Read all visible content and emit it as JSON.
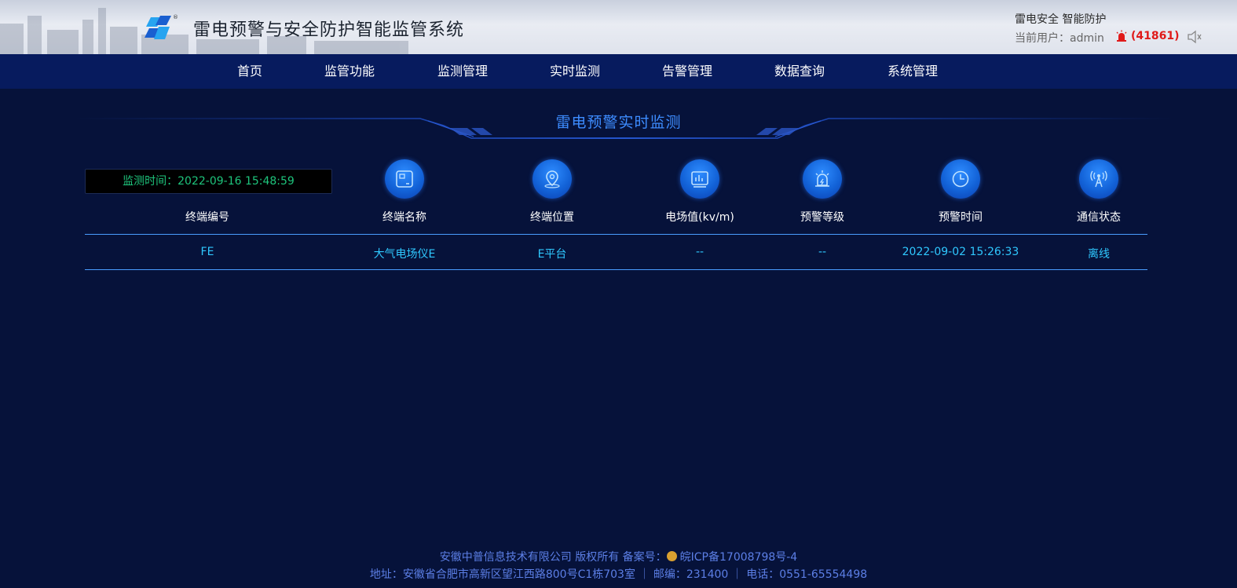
{
  "header": {
    "app_title": "雷电预警与安全防护智能监管系统",
    "slogans": [
      "雷电安全",
      "智能防护"
    ],
    "user_prefix": "当前用户：",
    "user_name": "admin",
    "alarm_count": "(41861)",
    "icons": {
      "alarm": "alarm-light-icon",
      "sound": "speaker-icon"
    }
  },
  "nav": {
    "items": [
      "首页",
      "监管功能",
      "监测管理",
      "实时监测",
      "告警管理",
      "数据查询",
      "系统管理"
    ]
  },
  "section": {
    "title": "雷电预警实时监测"
  },
  "monitor": {
    "label": "监测时间：",
    "time": "2022-09-16 15:48:59"
  },
  "table": {
    "columns": [
      {
        "label": "终端编号",
        "icon": null
      },
      {
        "label": "终端名称",
        "icon": "device-icon"
      },
      {
        "label": "终端位置",
        "icon": "location-icon"
      },
      {
        "label": "电场值(kv/m)",
        "icon": "chart-icon"
      },
      {
        "label": "预警等级",
        "icon": "warning-light-icon"
      },
      {
        "label": "预警时间",
        "icon": "clock-icon"
      },
      {
        "label": "通信状态",
        "icon": "signal-icon"
      }
    ],
    "rows": [
      [
        "FE",
        "大气电场仪E",
        "E平台",
        "--",
        "--",
        "2022-09-02 15:26:33",
        "离线"
      ]
    ]
  },
  "footer": {
    "line1_company": "安徽中普信息技术有限公司 版权所有 备案号：",
    "line1_icp": "皖ICP备17008798号-4",
    "line2": "地址：安徽省合肥市高新区望江西路800号C1栋703室 ｜ 邮编：231400 ｜ 电话：0551-65554498"
  },
  "colors": {
    "background": "#06123a",
    "nav": "#071b5e",
    "accent": "#2fc8ff",
    "time_text": "#1ec47c",
    "alarm": "#e01a1a"
  }
}
